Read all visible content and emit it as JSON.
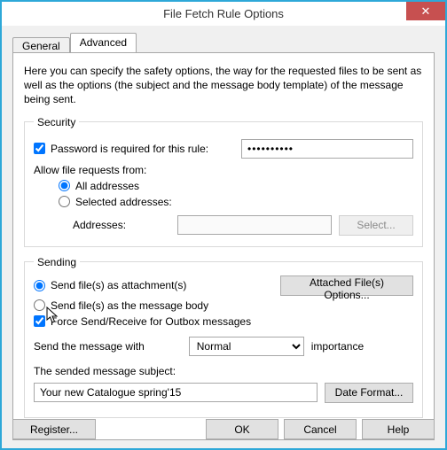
{
  "window": {
    "title": "File Fetch Rule Options"
  },
  "tabs": {
    "general": "General",
    "advanced": "Advanced"
  },
  "intro": "Here you can specify the safety options, the way for the requested files to be sent as well as the options (the subject and the message body template) of the message being sent.",
  "security": {
    "legend": "Security",
    "password_label": "Password is required for this rule:",
    "password_value": "••••••••••",
    "allow_label": "Allow file requests from:",
    "all_label": "All addresses",
    "selected_label": "Selected addresses:",
    "addresses_label": "Addresses:",
    "addresses_value": "",
    "select_btn": "Select..."
  },
  "sending": {
    "legend": "Sending",
    "as_attachment": "Send file(s) as attachment(s)",
    "as_body": "Send file(s) as the message body",
    "attached_options_btn": "Attached File(s) Options...",
    "force_label": "Force Send/Receive for Outbox messages",
    "sendwith_prefix": "Send the message with",
    "importance_value": "Normal",
    "importance_suffix": "importance",
    "subject_label": "The sended message subject:",
    "subject_value": "Your new Catalogue spring'15",
    "date_format_btn": "Date Format..."
  },
  "buttons": {
    "register": "Register...",
    "ok": "OK",
    "cancel": "Cancel",
    "help": "Help"
  }
}
